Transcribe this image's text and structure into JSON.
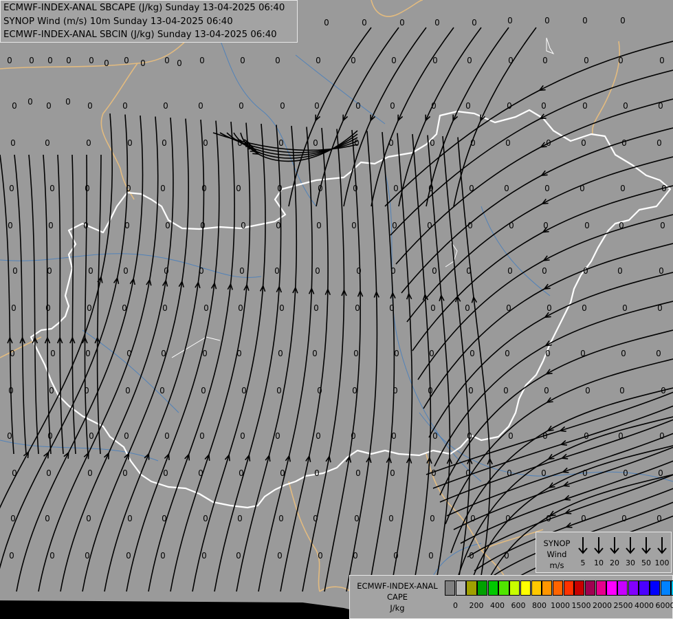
{
  "header": {
    "line1": "ECMWF-INDEX-ANAL SBCAPE (J/kg) Sunday 13-04-2025 06:40",
    "line2": "SYNOP Wind (m/s) 10m Sunday 13-04-2025 06:40",
    "line3": "ECMWF-INDEX-ANAL SBCIN (J/kg) Sunday 13-04-2025 06:40"
  },
  "colors": {
    "background": "#9a9a9a",
    "border_country": "#ffffff",
    "border_neighbor": "#e3bb7f",
    "rivers": "#3f7cc0",
    "streamlines": "#000000"
  },
  "grid_value_label": "0",
  "wind_legend": {
    "title": [
      "SYNOP",
      "Wind",
      "m/s"
    ],
    "arrows": [
      {
        "value": "5"
      },
      {
        "value": "10"
      },
      {
        "value": "20"
      },
      {
        "value": "30"
      },
      {
        "value": "50"
      },
      {
        "value": "100"
      }
    ]
  },
  "cape_legend": {
    "title": [
      "ECMWF-INDEX-ANAL",
      "CAPE",
      "J/kg"
    ],
    "colors": [
      "#808080",
      "#b4b4b4",
      "#a0a000",
      "#00a000",
      "#00c800",
      "#50e600",
      "#c8ff00",
      "#ffff00",
      "#ffc800",
      "#ff9600",
      "#ff6400",
      "#ff3200",
      "#c80000",
      "#a00050",
      "#e6008c",
      "#ff00ff",
      "#c800ff",
      "#8200ff",
      "#4b00ff",
      "#0000ff",
      "#0082ff",
      "#00c8ff",
      "#00ffff",
      "#ffffff"
    ],
    "ticks": [
      "0",
      "200",
      "400",
      "600",
      "800",
      "1000",
      "1500",
      "2000",
      "2500",
      "4000",
      "6000"
    ]
  }
}
